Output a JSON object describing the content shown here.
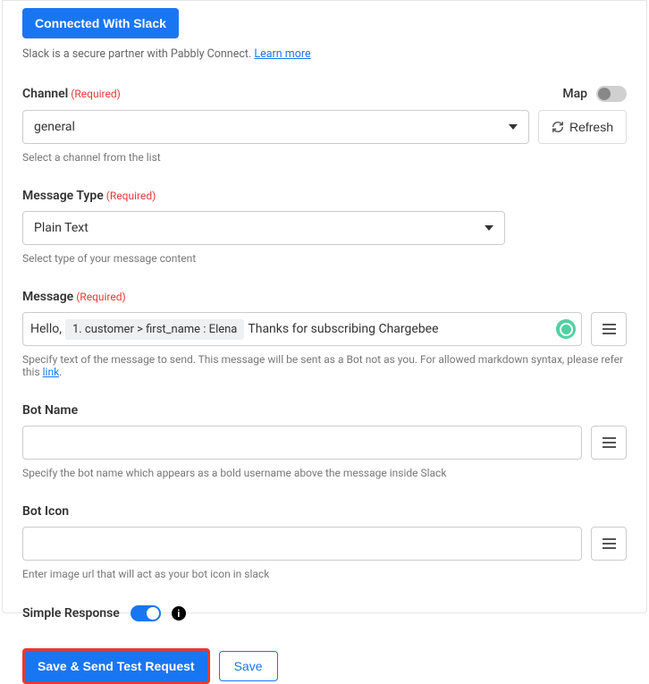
{
  "header": {
    "connected_label": "Connected With Slack",
    "partner_text": "Slack is a secure partner with Pabbly Connect. ",
    "learn_more": "Learn more"
  },
  "channel": {
    "label": "Channel",
    "required": "(Required)",
    "map_label": "Map",
    "value": "general",
    "refresh_label": "Refresh",
    "helper": "Select a channel from the list"
  },
  "message_type": {
    "label": "Message Type",
    "required": "(Required)",
    "value": "Plain Text",
    "helper": "Select type of your message content"
  },
  "message": {
    "label": "Message",
    "required": "(Required)",
    "text_before": "Hello, ",
    "chip": "1. customer > first_name : Elena",
    "text_after": " Thanks for subscribing Chargebee",
    "helper": "Specify text of the message to send. This message will be sent as a Bot not as you. For allowed markdown syntax, please refer this ",
    "helper_link": "link"
  },
  "bot_name": {
    "label": "Bot Name",
    "value": "",
    "helper": "Specify the bot name which appears as a bold username above the message inside Slack"
  },
  "bot_icon": {
    "label": "Bot Icon",
    "value": "",
    "helper": "Enter image url that will act as your bot icon in slack"
  },
  "simple_response": {
    "label": "Simple Response"
  },
  "actions": {
    "save_send": "Save & Send Test Request",
    "save": "Save"
  }
}
